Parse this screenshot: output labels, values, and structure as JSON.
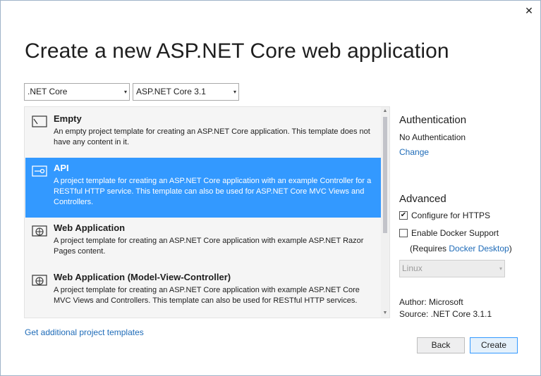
{
  "title": "Create a new ASP.NET Core web application",
  "filters": {
    "framework": ".NET Core",
    "version": "ASP.NET Core 3.1"
  },
  "templates": [
    {
      "name": "Empty",
      "description": "An empty project template for creating an ASP.NET Core application. This template does not have any content in it.",
      "icon": "empty-template-icon",
      "selected": false
    },
    {
      "name": "API",
      "description": "A project template for creating an ASP.NET Core application with an example Controller for a RESTful HTTP service. This template can also be used for ASP.NET Core MVC Views and Controllers.",
      "icon": "api-template-icon",
      "selected": true
    },
    {
      "name": "Web Application",
      "description": "A project template for creating an ASP.NET Core application with example ASP.NET Razor Pages content.",
      "icon": "globe-template-icon",
      "selected": false
    },
    {
      "name": "Web Application (Model-View-Controller)",
      "description": "A project template for creating an ASP.NET Core application with example ASP.NET Core MVC Views and Controllers. This template can also be used for RESTful HTTP services.",
      "icon": "globe-template-icon",
      "selected": false
    }
  ],
  "authentication": {
    "heading": "Authentication",
    "value": "No Authentication",
    "change_label": "Change"
  },
  "advanced": {
    "heading": "Advanced",
    "https_label": "Configure for HTTPS",
    "https_checked": true,
    "docker_label": "Enable Docker Support",
    "docker_checked": false,
    "requires_prefix": "(Requires ",
    "requires_link": "Docker Desktop",
    "requires_suffix": ")",
    "os_value": "Linux"
  },
  "meta": {
    "author_label": "Author:",
    "author_value": "Microsoft",
    "source_label": "Source:",
    "source_value": ".NET Core 3.1.1"
  },
  "additional_link": "Get additional project templates",
  "buttons": {
    "back": "Back",
    "create": "Create"
  },
  "colors": {
    "selection": "#3399ff",
    "link": "#1e6bb8"
  }
}
